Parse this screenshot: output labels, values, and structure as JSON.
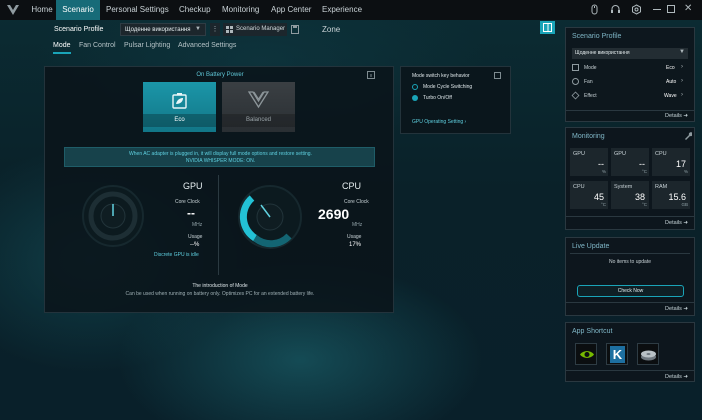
{
  "nav": {
    "items": [
      "Home",
      "Scenario",
      "Personal Settings",
      "Checkup",
      "Monitoring",
      "App Center",
      "Experience Zone"
    ],
    "active": "Scenario"
  },
  "profile_bar": {
    "label": "Scenario Profile",
    "selected": "Щоденне використання",
    "manager": "Scenario Manager"
  },
  "tabs": [
    "Mode",
    "Fan Control",
    "Pulsar Lighting",
    "Advanced Settings"
  ],
  "mode": {
    "title": "On Battery Power",
    "cards": [
      "Eco",
      "Balanced"
    ]
  },
  "switch_panel": {
    "title": "Mode switch key behavior",
    "options": [
      "Mode Cycle Switching",
      "Turbo On/Off"
    ],
    "link": "GPU Operating Setting"
  },
  "notice": {
    "line1": "When AC adapter is plugged in, it will display full mode options and restore setting.",
    "line2": "NVIDIA WHISPER MODE: ON."
  },
  "gpu": {
    "title": "GPU",
    "clock_label": "Core Clock",
    "clock_value": "--",
    "clock_unit": "MHz",
    "usage_label": "Usage",
    "usage_value": "--%",
    "status": "Discrete GPU is idle"
  },
  "cpu": {
    "title": "CPU",
    "clock_label": "Core Clock",
    "clock_value": "2690",
    "clock_unit": "MHz",
    "usage_label": "Usage",
    "usage_value": "17%"
  },
  "intro": {
    "title": "The introduction of Mode",
    "text": "Can be used when running on battery only. Optimizes PC for an extended battery life."
  },
  "right": {
    "profile": {
      "title": "Scenario Profile",
      "selected": "Щоденне використання",
      "rows": [
        {
          "label": "Mode",
          "value": "Eco"
        },
        {
          "label": "Fan",
          "value": "Auto"
        },
        {
          "label": "Effect",
          "value": "Wave"
        }
      ],
      "details": "Details"
    },
    "monitoring": {
      "title": "Monitoring",
      "cells": [
        {
          "label": "GPU",
          "value": "--",
          "unit": "%"
        },
        {
          "label": "GPU",
          "value": "--",
          "unit": "°C"
        },
        {
          "label": "CPU",
          "value": "17",
          "unit": "%"
        },
        {
          "label": "CPU",
          "value": "45",
          "unit": "°C"
        },
        {
          "label": "System",
          "value": "38",
          "unit": "°C"
        },
        {
          "label": "RAM",
          "value": "15.6",
          "unit": "GB"
        }
      ],
      "details": "Details"
    },
    "live_update": {
      "title": "Live Update",
      "empty": "No items to update",
      "button": "Check Now",
      "details": "Details"
    },
    "shortcut": {
      "title": "App Shortcut",
      "apps": [
        "nvidia-app",
        "k-app",
        "disk-app"
      ],
      "details": "Details"
    }
  },
  "colors": {
    "accent": "#1aa4b8",
    "active_nav": "#176b78",
    "teal_card": "#17889a"
  }
}
